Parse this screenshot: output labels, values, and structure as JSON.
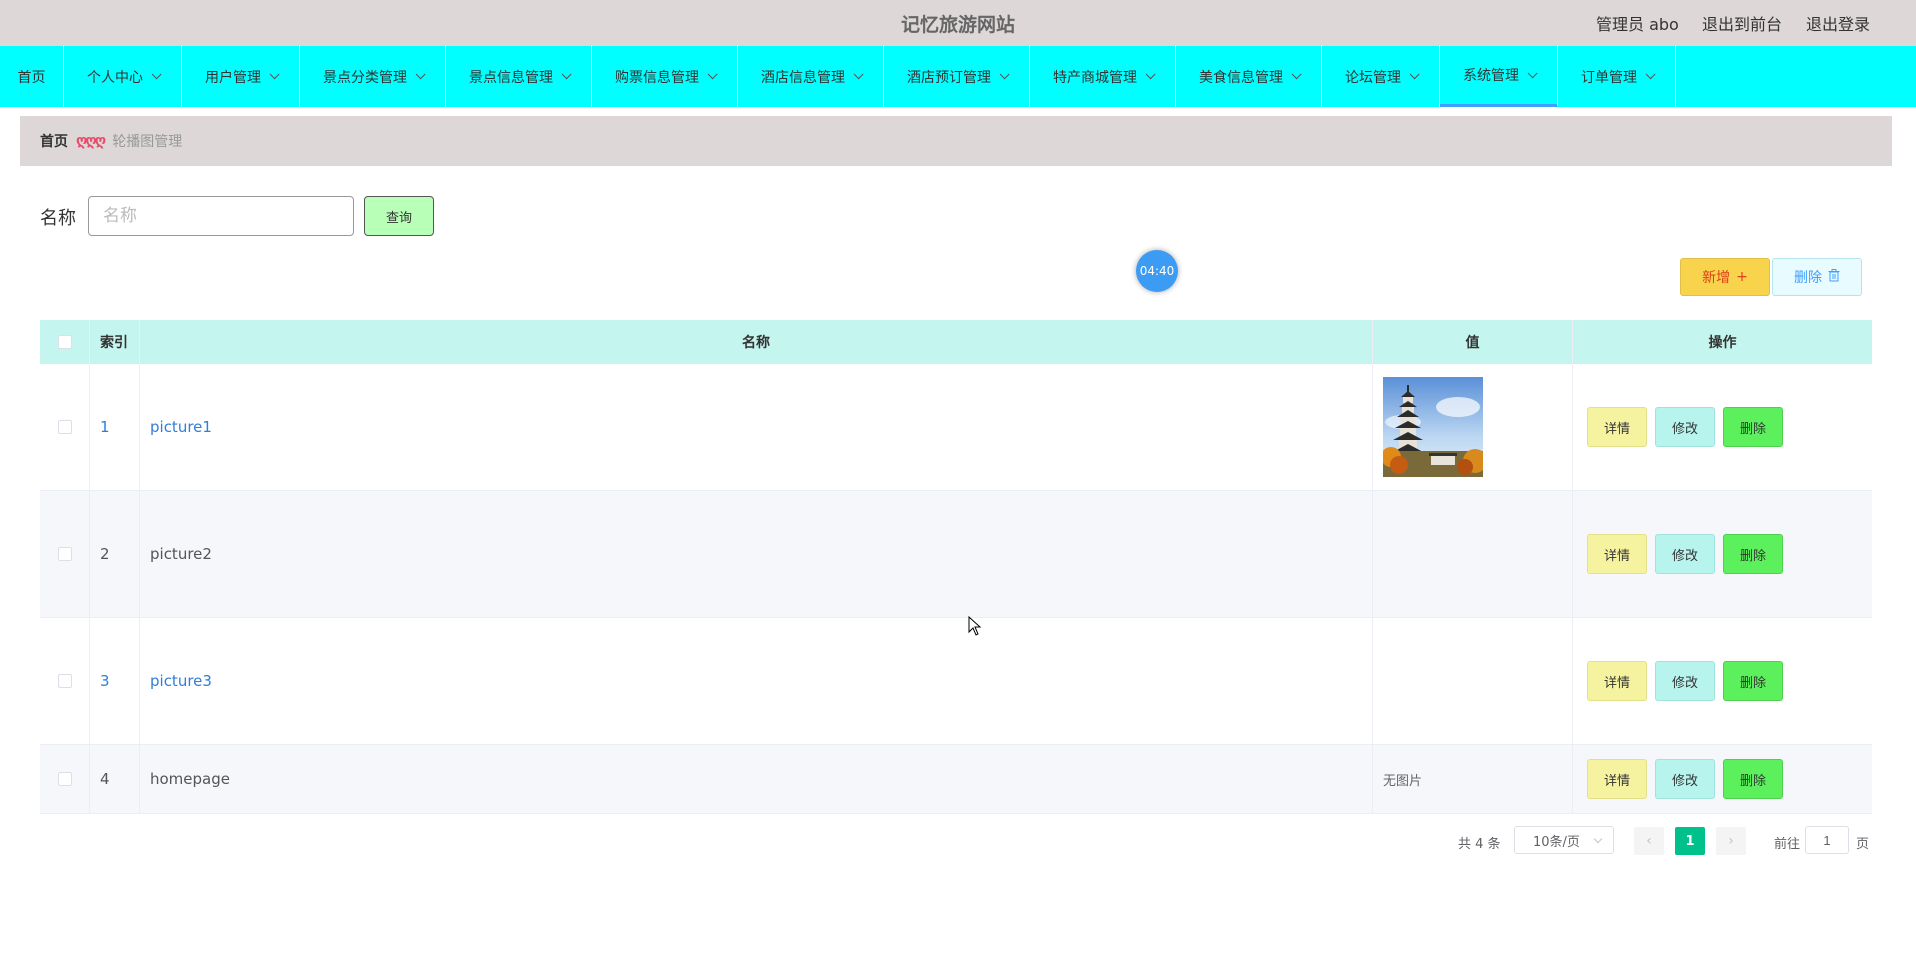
{
  "header": {
    "title": "记忆旅游网站",
    "user": "管理员 abo",
    "to_front": "退出到前台",
    "logout": "退出登录"
  },
  "nav": {
    "items": [
      {
        "label": "首页"
      },
      {
        "label": "个人中心"
      },
      {
        "label": "用户管理"
      },
      {
        "label": "景点分类管理"
      },
      {
        "label": "景点信息管理"
      },
      {
        "label": "购票信息管理"
      },
      {
        "label": "酒店信息管理"
      },
      {
        "label": "酒店预订管理"
      },
      {
        "label": "特产商城管理"
      },
      {
        "label": "美食信息管理"
      },
      {
        "label": "论坛管理"
      },
      {
        "label": "系统管理"
      },
      {
        "label": "订单管理"
      }
    ],
    "active": "系统管理"
  },
  "breadcrumb": {
    "home": "首页",
    "separator": "ღღღ",
    "current": "轮播图管理"
  },
  "search": {
    "label": "名称",
    "placeholder": "名称",
    "value": "",
    "button": "查询"
  },
  "timer": "04:40",
  "actions": {
    "add": "新增",
    "add_icon": "+",
    "delete": "删除",
    "delete_icon": "🗑"
  },
  "table": {
    "headers": [
      "索引",
      "名称",
      "值",
      "操作"
    ],
    "rows": [
      {
        "index": "1",
        "name": "picture1",
        "value": "image",
        "value_text": ""
      },
      {
        "index": "2",
        "name": "picture2",
        "value": "image",
        "value_text": ""
      },
      {
        "index": "3",
        "name": "picture3",
        "value": "image",
        "value_text": ""
      },
      {
        "index": "4",
        "name": "homepage",
        "value": "none",
        "value_text": "无图片"
      }
    ],
    "ops": {
      "detail": "详情",
      "edit": "修改",
      "remove": "删除"
    }
  },
  "pagination": {
    "total": "共 4 条",
    "page_size": "10条/页",
    "prev_icon": "‹",
    "next_icon": "›",
    "current_page": "1",
    "goto_label": "前往",
    "goto_value": "1",
    "goto_suffix": "页"
  },
  "colors": {
    "nav_bg": "#00ffff",
    "header_bg": "#ddd7d7",
    "table_head_bg": "#c4f5ee",
    "active_page": "#00c08b"
  }
}
